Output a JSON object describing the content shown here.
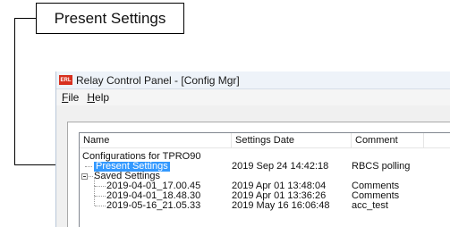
{
  "callout": {
    "text": "Present Settings"
  },
  "window": {
    "title": "Relay Control Panel - [Config Mgr]",
    "app_icon": "ERL"
  },
  "menu": {
    "file_mnemonic": "F",
    "file_rest": "ile",
    "help_mnemonic": "H",
    "help_rest": "elp"
  },
  "table": {
    "columns": [
      "Name",
      "Settings Date",
      "Comment"
    ],
    "root": "Configurations for TPRO90",
    "present": {
      "name": "Present Settings",
      "date": "2019 Sep 24 14:42:18",
      "comment": "RBCS polling"
    },
    "saved_label": "Saved Settings",
    "saved": [
      {
        "name": "2019-04-01_17.00.45",
        "date": "2019 Apr 01 13:48:04",
        "comment": "Comments"
      },
      {
        "name": "2019-04-01_18.48.30",
        "date": "2019 Apr 01 13:36:26",
        "comment": "Comments"
      },
      {
        "name": "2019-05-16_21.05.33",
        "date": "2019 May 16 16:06:48",
        "comment": "acc_test"
      }
    ]
  }
}
